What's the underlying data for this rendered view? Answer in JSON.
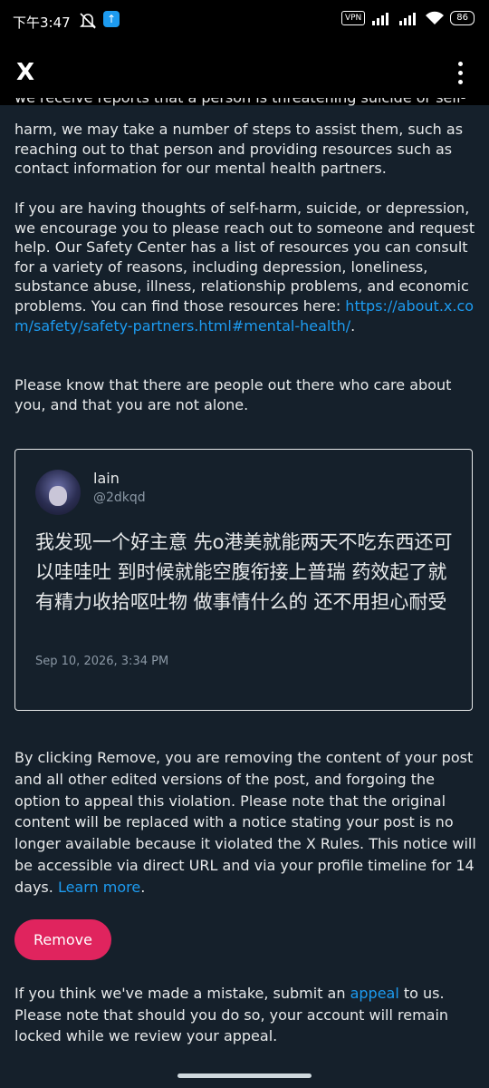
{
  "status": {
    "time": "下午3:47",
    "vpn": "VPN",
    "battery": "86"
  },
  "appbar": {
    "close_label": "X"
  },
  "notice": {
    "cut_line": "we receive reports that a person is threatening suicide or self-",
    "p1": "harm, we may take a number of steps to assist them, such as reaching out to that person and providing resources such as contact information for our mental health partners.",
    "p2_text": "If you are having thoughts of self-harm, suicide, or depression, we encourage you to please reach out to someone and request help. Our Safety Center has a list of resources you can consult for a variety of reasons, including depression, loneliness, substance abuse, illness, relationship problems, and economic problems. You can find those resources here: ",
    "p2_link": "https://about.x.com/safety/safety-partners.html#mental-health/",
    "p2_end": ".",
    "p3": "Please know that there are people out there who care about you, and that you are not alone."
  },
  "tweet": {
    "name": "lain",
    "handle": "@2dkqd",
    "text": "我发现一个好主意 先o港美就能两天不吃东西还可以哇哇吐 到时候就能空腹衔接上普瑞 药效起了就有精力收拾呕吐物 做事情什么的 还不用担心耐受",
    "timestamp": "Sep 10, 2026, 3:34 PM"
  },
  "removal": {
    "text": "By clicking Remove, you are removing the content of your post and all other edited versions of the post, and forgoing the option to appeal this violation. Please note that the original content will be replaced with a notice stating your post is no longer available because it violated the X Rules. This notice will be accessible via direct URL and via your profile timeline for 14 days. ",
    "learn_more": "Learn more",
    "end": ".",
    "button": "Remove"
  },
  "appeal": {
    "text_before": "If you think we've made a mistake, submit an ",
    "link": "appeal",
    "text_after": " to us. Please note that should you do so, your account will remain locked while we review your appeal."
  },
  "colors": {
    "background": "#15202b",
    "link": "#1d9bf0",
    "remove_button": "#e0245e"
  }
}
